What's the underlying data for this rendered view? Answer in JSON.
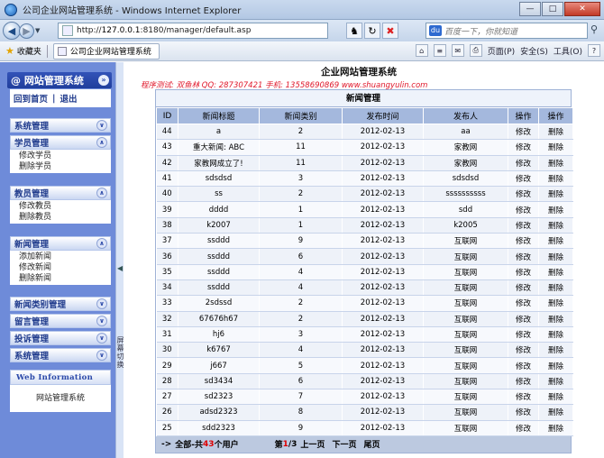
{
  "browser": {
    "window_title": "公司企业网站管理系统 - Windows Internet Explorer",
    "url_prefix": "http://",
    "url_host": "127.0.0.1",
    "url_rest": ":8180/manager/default.asp",
    "search_placeholder": "百度一下，你就知道",
    "favorites_label": "收藏夹",
    "tab_title": "公司企业网站管理系统",
    "commands": [
      "页面(P)",
      "安全(S)",
      "工具(O)"
    ],
    "help_icon": "?"
  },
  "sidebar": {
    "brand": "@ 网站管理系统",
    "home": "回到首页",
    "home_sep": "|",
    "logout": "退出",
    "groups": [
      {
        "title": "系统管理",
        "items": []
      },
      {
        "title": "学员管理",
        "items": [
          "修改学员",
          "删除学员"
        ]
      },
      {
        "title": "教员管理",
        "items": [
          "修改教员",
          "删除教员"
        ]
      },
      {
        "title": "新闻管理",
        "items": [
          "添加新闻",
          "修改新闻",
          "删除新闻"
        ]
      },
      {
        "title": "新闻类别管理",
        "items": []
      },
      {
        "title": "留言管理",
        "items": []
      },
      {
        "title": "投诉管理",
        "items": []
      },
      {
        "title": "系统管理",
        "items": []
      }
    ],
    "web_info_title": "Web Information",
    "web_info_body": "网站管理系统",
    "splitter_text": "屏幕切换"
  },
  "main": {
    "title": "企业网站管理系统",
    "credits": "程序测试: 双鱼林  QQ: 287307421  手机: 13558690869  www.shuangyulin.com",
    "table_caption": "新闻管理",
    "columns": [
      "ID",
      "新闻标题",
      "新闻类别",
      "发布时间",
      "发布人",
      "操作",
      "操作"
    ],
    "rows": [
      [
        "44",
        "a",
        "2",
        "2012-02-13",
        "aa",
        "修改",
        "删除"
      ],
      [
        "43",
        "重大新闻: ABC",
        "11",
        "2012-02-13",
        "家教网",
        "修改",
        "删除"
      ],
      [
        "42",
        "家教网成立了!",
        "11",
        "2012-02-13",
        "家教网",
        "修改",
        "删除"
      ],
      [
        "41",
        "sdsdsd",
        "3",
        "2012-02-13",
        "sdsdsd",
        "修改",
        "删除"
      ],
      [
        "40",
        "ss",
        "2",
        "2012-02-13",
        "ssssssssss",
        "修改",
        "删除"
      ],
      [
        "39",
        "dddd",
        "1",
        "2012-02-13",
        "sdd",
        "修改",
        "删除"
      ],
      [
        "38",
        "k2007",
        "1",
        "2012-02-13",
        "k2005",
        "修改",
        "删除"
      ],
      [
        "37",
        "ssddd",
        "9",
        "2012-02-13",
        "互联网",
        "修改",
        "删除"
      ],
      [
        "36",
        "ssddd",
        "6",
        "2012-02-13",
        "互联网",
        "修改",
        "删除"
      ],
      [
        "35",
        "ssddd",
        "4",
        "2012-02-13",
        "互联网",
        "修改",
        "删除"
      ],
      [
        "34",
        "ssddd",
        "4",
        "2012-02-13",
        "互联网",
        "修改",
        "删除"
      ],
      [
        "33",
        "2sdssd",
        "2",
        "2012-02-13",
        "互联网",
        "修改",
        "删除"
      ],
      [
        "32",
        "67676h67",
        "2",
        "2012-02-13",
        "互联网",
        "修改",
        "删除"
      ],
      [
        "31",
        "hj6",
        "3",
        "2012-02-13",
        "互联网",
        "修改",
        "删除"
      ],
      [
        "30",
        "k6767",
        "4",
        "2012-02-13",
        "互联网",
        "修改",
        "删除"
      ],
      [
        "29",
        "j667",
        "5",
        "2012-02-13",
        "互联网",
        "修改",
        "删除"
      ],
      [
        "28",
        "sd3434",
        "6",
        "2012-02-13",
        "互联网",
        "修改",
        "删除"
      ],
      [
        "27",
        "sd2323",
        "7",
        "2012-02-13",
        "互联网",
        "修改",
        "删除"
      ],
      [
        "26",
        "adsd2323",
        "8",
        "2012-02-13",
        "互联网",
        "修改",
        "删除"
      ],
      [
        "25",
        "sdd2323",
        "9",
        "2012-02-13",
        "互联网",
        "修改",
        "删除"
      ]
    ],
    "footer": {
      "arrow": "->",
      "total_prefix": "全部-共",
      "total": "43",
      "total_suffix": "个用户",
      "page_prefix": "第",
      "page_current": "1",
      "page_suffix": "/3",
      "prev": "上一页",
      "next": "下一页",
      "last": "尾页"
    }
  }
}
